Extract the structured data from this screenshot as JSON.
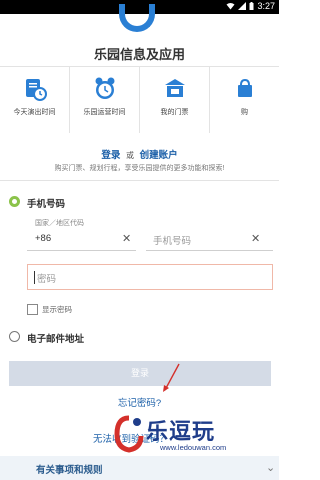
{
  "status_bar": {
    "time": "3:27"
  },
  "section_title": "乐园信息及应用",
  "features": [
    {
      "label": "今天演出时间",
      "icon": "schedule-clock-icon"
    },
    {
      "label": "乐园运营时间",
      "icon": "alarm-clock-icon"
    },
    {
      "label": "我的门票",
      "icon": "ticket-icon"
    },
    {
      "label": "购",
      "icon": "shopping-icon"
    }
  ],
  "auth": {
    "login": "登录",
    "or": "或",
    "create": "创建账户"
  },
  "subtext": "购买门票、规划行程，享受乐园提供的更多功能和探索!",
  "phone_option": {
    "label": "手机号码",
    "selected": true
  },
  "country_field": {
    "label": "国家／地区代码",
    "value": "+86"
  },
  "phone_field": {
    "placeholder": "手机号码"
  },
  "password_field": {
    "placeholder": "密码"
  },
  "show_password": {
    "label": "显示密码",
    "checked": false
  },
  "email_option": {
    "label": "电子邮件地址",
    "selected": false
  },
  "login_button": {
    "label": "登录"
  },
  "forgot_link": "忘记密码?",
  "unable_link": "无法收到验证码？",
  "bottom_bar": {
    "label": "有关事项和规则",
    "icon": "chevron-down-icon"
  },
  "watermark": {
    "name": "乐逗玩",
    "url": "www.ledouwan.com"
  },
  "colors": {
    "accent": "#1b5fa8",
    "radio_on": "#8bc34a",
    "button_disabled": "#d4dbe6"
  }
}
